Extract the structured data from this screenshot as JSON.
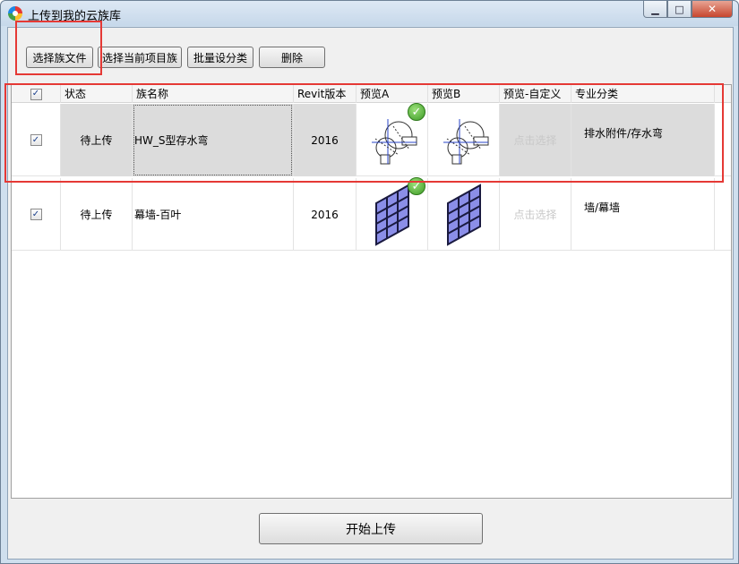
{
  "window": {
    "title": "上传到我的云族库",
    "min_glyph": "▁",
    "max_glyph": "□",
    "close_glyph": "✕"
  },
  "toolbar": {
    "select_family_files": "选择族文件",
    "select_project_families": "选择当前项目族",
    "batch_category": "批量设分类",
    "delete": "删除"
  },
  "table": {
    "columns": [
      "状态",
      "族名称",
      "Revit版本",
      "预览A",
      "预览B",
      "预览-自定义",
      "专业分类"
    ],
    "header_checked": true,
    "rows": [
      {
        "checked": true,
        "status": "待上传",
        "name": "HW_S型存水弯",
        "revit": "2016",
        "preview_custom": "点击选择",
        "category": "排水附件/存水弯",
        "badge": "✓"
      },
      {
        "checked": true,
        "status": "待上传",
        "name": "幕墙-百叶",
        "revit": "2016",
        "preview_custom": "点击选择",
        "category": "墙/幕墙",
        "badge": "✓"
      }
    ]
  },
  "footer": {
    "start_upload": "开始上传"
  },
  "colors": {
    "highlight": "#e53935",
    "check_mark": "#1a3f8c",
    "badge": "#3c9a25",
    "mullion": "#1a1a40",
    "glass": "#8b8ee8"
  }
}
